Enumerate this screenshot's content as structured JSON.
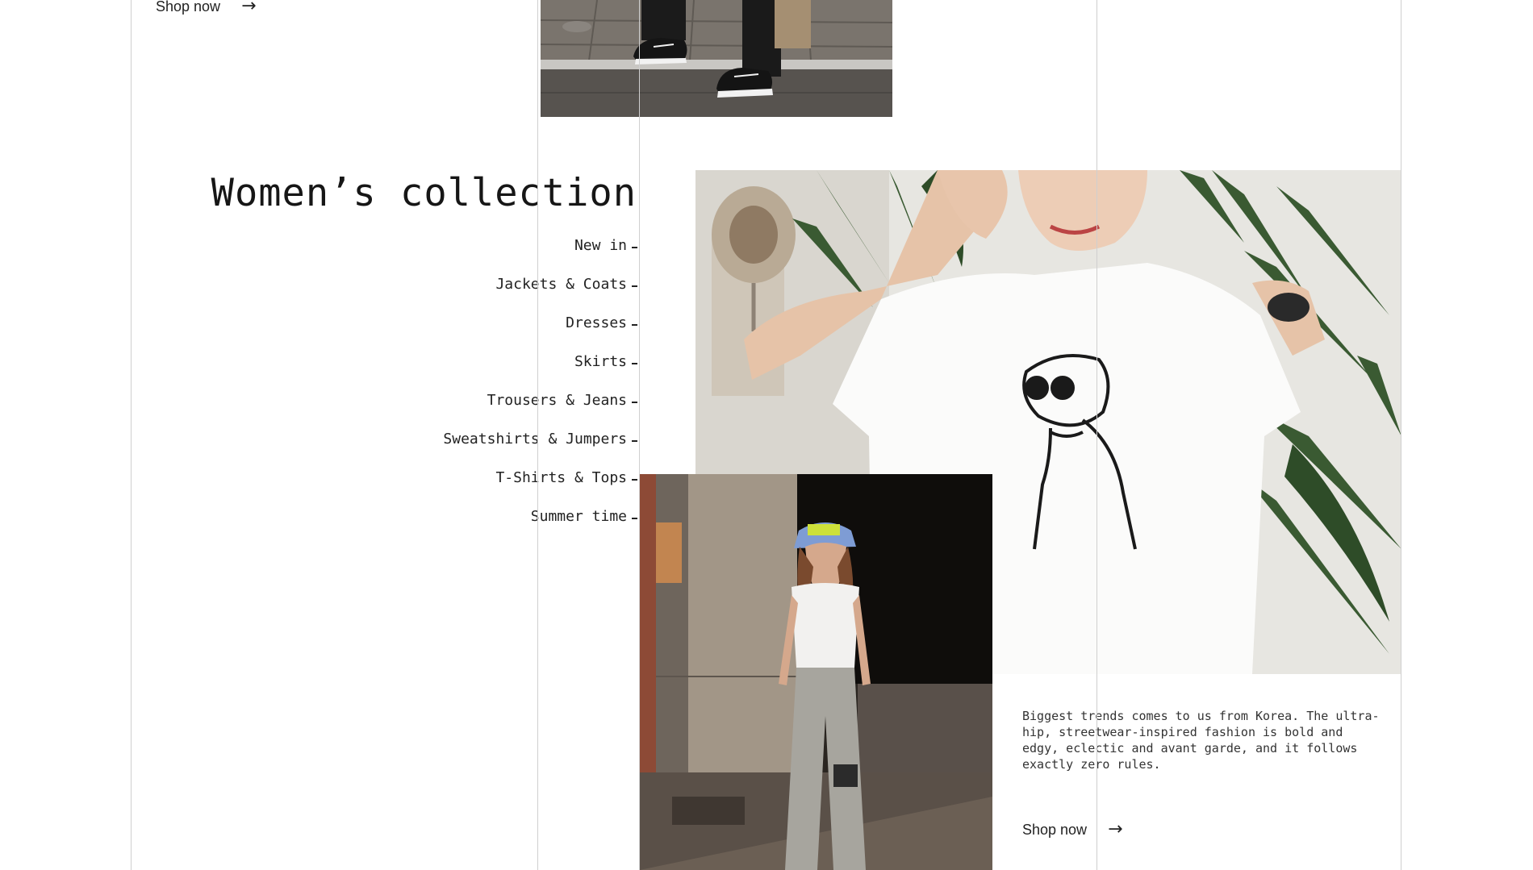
{
  "top_promo": {
    "shop_label": "Shop now",
    "arrow": "→"
  },
  "collection": {
    "title": "Women’s collection",
    "categories": [
      {
        "label": "New in"
      },
      {
        "label": "Jackets & Coats"
      },
      {
        "label": "Dresses"
      },
      {
        "label": "Skirts"
      },
      {
        "label": "Trousers & Jeans"
      },
      {
        "label": "Sweatshirts & Jumpers"
      },
      {
        "label": "T-Shirts & Tops"
      },
      {
        "label": "Summer time"
      }
    ]
  },
  "feature": {
    "description": "Biggest trends comes to us from Korea. The ultra-hip, streetwear-inspired fashion is bold and edgy, eclectic and avant garde, and it follows exactly zero rules.",
    "shop_label": "Shop now",
    "arrow": "→"
  },
  "images": {
    "top_photo": "sneakers-street-photo",
    "main_photo": "white-graphic-tshirt-photo",
    "street_photo": "bucket-hat-cargo-pants-photo"
  }
}
